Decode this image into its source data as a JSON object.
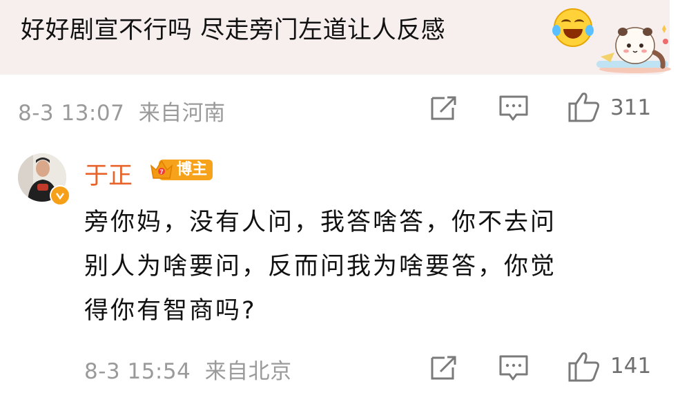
{
  "comment": {
    "text": "好好剧宣不行吗 尽走旁门左道让人反感",
    "emoji": "laughing-crying-emoji",
    "sticker": "panda-cat-sticker",
    "timestamp": "8-3 13:07",
    "location": "来自河南",
    "likes": "311"
  },
  "reply": {
    "username": "于正",
    "badge": "博主",
    "lines": [
      "旁你妈，没有人问，我答啥答，你不去问",
      "别人为啥要问，反而问我为啥要答，你觉",
      "得你有智商吗?"
    ],
    "timestamp": "8-3 15:54",
    "location": "来自北京",
    "likes": "141"
  },
  "colors": {
    "bubble_bg": "#f7eeee",
    "username": "#e8632a",
    "badge": "#f7a21b",
    "meta": "#9a9a9a"
  }
}
